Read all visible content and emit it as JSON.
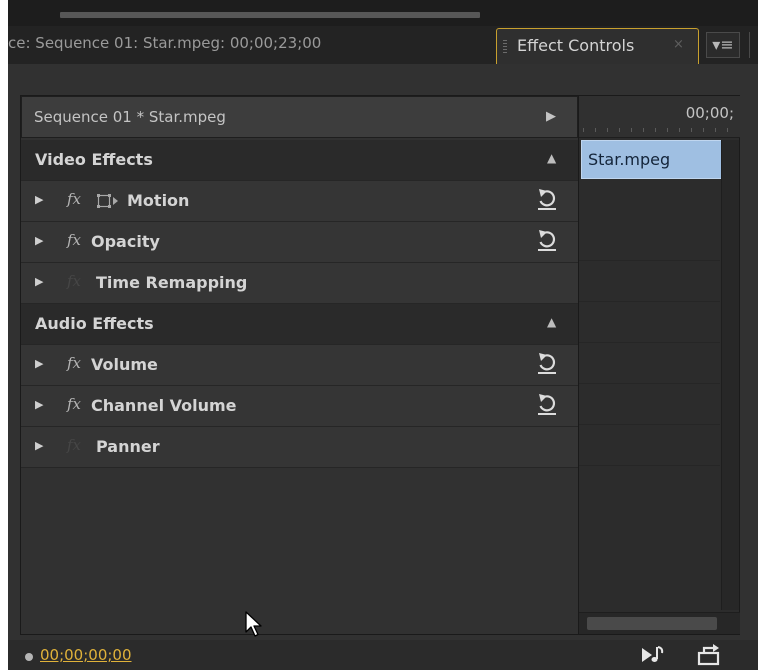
{
  "tabs": {
    "source_label": "ce: Sequence 01: Star.mpeg: 00;00;23;00",
    "active_label": "Effect Controls",
    "close_glyph": "×",
    "menu_glyph": "▾≡"
  },
  "clip_header": {
    "label": "Sequence 01 * Star.mpeg",
    "play_glyph": "▶"
  },
  "sections": {
    "video": {
      "label": "Video Effects",
      "effects": [
        {
          "label": "Motion",
          "fx_enabled": true,
          "has_reset": true
        },
        {
          "label": "Opacity",
          "fx_enabled": true,
          "has_reset": true
        },
        {
          "label": "Time Remapping",
          "fx_enabled": false,
          "has_reset": false
        }
      ]
    },
    "audio": {
      "label": "Audio Effects",
      "effects": [
        {
          "label": "Volume",
          "fx_enabled": true,
          "has_reset": true
        },
        {
          "label": "Channel Volume",
          "fx_enabled": true,
          "has_reset": true
        },
        {
          "label": "Panner",
          "fx_enabled": false,
          "has_reset": false
        }
      ]
    }
  },
  "glyphs": {
    "disclosure": "▶",
    "collapse": "▲",
    "fx": "fx"
  },
  "timeline": {
    "time": "00;00;",
    "clip_label": "Star.mpeg"
  },
  "footer": {
    "timecode": "00;00;00;00"
  },
  "icons": {
    "reset": "reset-icon",
    "motion": "motion-transform-icon",
    "play_audio": "play-audio-icon",
    "export": "export-icon",
    "cursor": "mouse-pointer-icon"
  },
  "colors": {
    "accent_timecode": "#e0b23a",
    "clip_block": "#9fbfe2",
    "panel_bg": "#313131",
    "tab_border": "#c8a02e"
  }
}
